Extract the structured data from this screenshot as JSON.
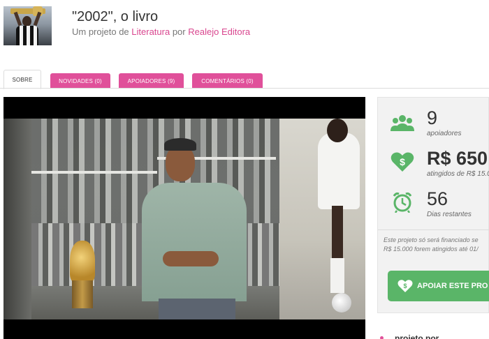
{
  "project": {
    "title": "\"2002\", o livro",
    "subtitle_prefix": "Um projeto de",
    "category": "Literatura",
    "subtitle_by": "por",
    "author": "Realejo Editora"
  },
  "tabs": [
    {
      "label": "SOBRE"
    },
    {
      "label": "NOVIDADES (0)"
    },
    {
      "label": "APOIADORES (9)"
    },
    {
      "label": "COMENTÁRIOS (0)"
    }
  ],
  "stats": {
    "supporters": {
      "value": "9",
      "label": "apoiadores"
    },
    "raised": {
      "value": "R$ 650",
      "label": "atingidos de R$ 15.0"
    },
    "days": {
      "value": "56",
      "label": "Dias restantes"
    }
  },
  "note": {
    "line1": "Este projeto só será financiado se",
    "line2": "R$ 15.000 forem atingidos até 01/"
  },
  "support_button": {
    "label": "APOIAR ESTE PRO"
  },
  "sidebar_footer": {
    "label": "projeto por"
  },
  "colors": {
    "accent_pink": "#e0509a",
    "accent_green": "#5ab568"
  }
}
